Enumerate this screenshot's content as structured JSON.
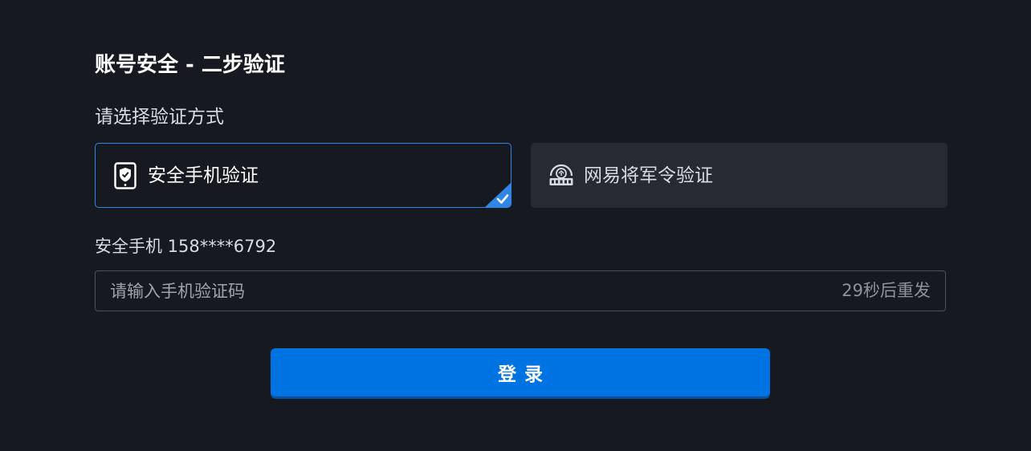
{
  "header": {
    "title": "账号安全 - 二步验证",
    "subtitle": "请选择验证方式"
  },
  "methods": [
    {
      "label": "安全手机验证",
      "icon": "shield-phone-icon",
      "selected": true
    },
    {
      "label": "网易将军令验证",
      "icon": "token-device-icon",
      "selected": false
    }
  ],
  "phone": {
    "label": "安全手机 158****6792"
  },
  "code_input": {
    "placeholder": "请输入手机验证码",
    "value": "",
    "resend_label": "29秒后重发"
  },
  "submit": {
    "label": "登录"
  },
  "colors": {
    "background": "#161920",
    "accent": "#0073e2",
    "selected_border": "#2f86e5",
    "card_unselected": "#262a33"
  }
}
